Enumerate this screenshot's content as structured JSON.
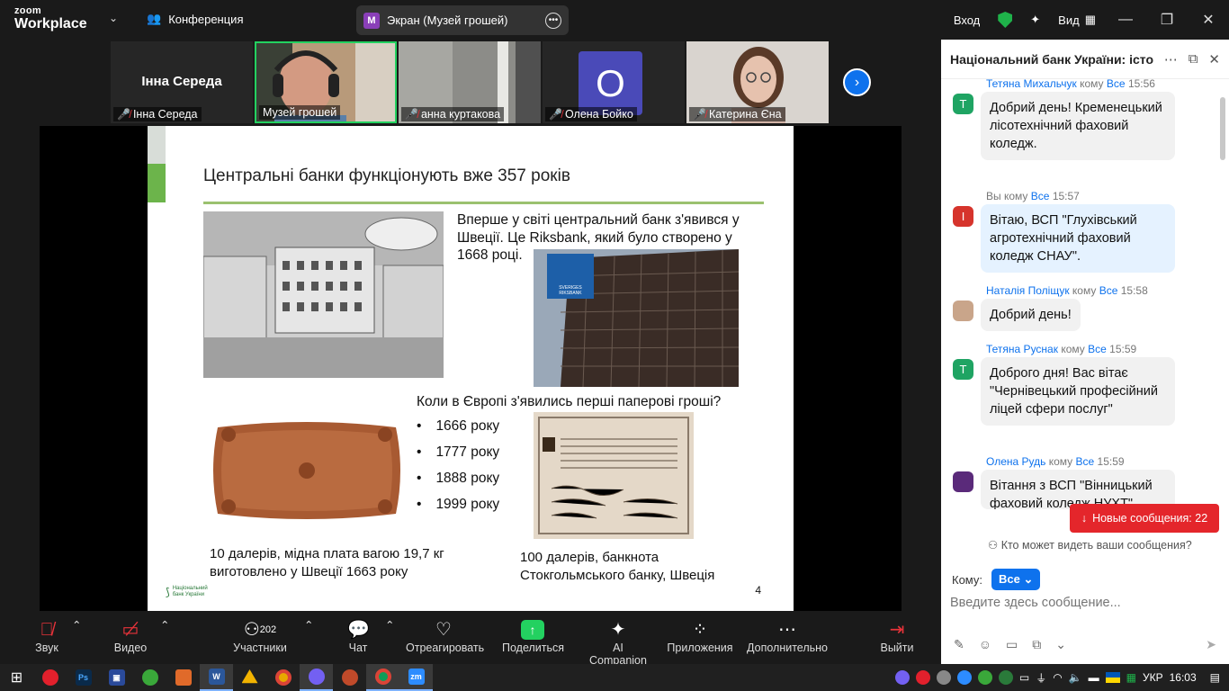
{
  "titlebar": {
    "logo_line1": "zoom",
    "logo_line2": "Workplace",
    "conference": "Конференция",
    "screen_label": "Экран (Музей грошей)",
    "screen_badge": "M",
    "signin": "Вход",
    "view": "Вид"
  },
  "gallery": {
    "tiles": [
      {
        "name": "Інна Середа",
        "big_name": "Інна Середа"
      },
      {
        "name": "Музей грошей"
      },
      {
        "name": "анна куртакова"
      },
      {
        "name": "Олена Бойко",
        "initial": "О"
      },
      {
        "name": "Катерина Єна"
      }
    ]
  },
  "slide": {
    "title": "Центральні банки функціонують вже 357 років",
    "intro": "Вперше у світі центральний банк з'явився у Швеції. Це Riksbank, який було створено у 1668 році.",
    "question": "Коли в Європі з'явились перші паперові гроші?",
    "options": [
      "1666 року",
      "1777 року",
      "1888 року",
      "1999 року"
    ],
    "caption_left": "10 далерів, мідна плата вагою 19,7 кг виготовлено у Швеції 1663 року",
    "caption_right": "100 далерів, банкнота Стокгольмського банку, Швеція",
    "page": "4",
    "footer_logo": "Національний банк України",
    "riksbank_label": "SVERIGES RIKSBANK"
  },
  "chat": {
    "title": "Національний банк України: істо...",
    "messages": [
      {
        "sender": "Тетяна Михальчук",
        "to_word": "кому",
        "to": "Все",
        "time": "15:56",
        "avatar": "T",
        "avatar_color": "#1fa463",
        "text": "Добрий день! Кременецький лісотехнічний фаховий коледж."
      },
      {
        "sender": "Вы",
        "to_word": "кому",
        "to": "Все",
        "time": "15:57",
        "avatar": "I",
        "avatar_color": "#d6342c",
        "text": "Вітаю, ВСП \"Глухівський агротехнічний фаховий коледж СНАУ\"."
      },
      {
        "sender": "Наталія Поліщук",
        "to_word": "кому",
        "to": "Все",
        "time": "15:58",
        "avatar": "",
        "avatar_color": "#c9a58a",
        "text": "Добрий день!"
      },
      {
        "sender": "Тетяна Руснак",
        "to_word": "кому",
        "to": "Все",
        "time": "15:59",
        "avatar": "T",
        "avatar_color": "#1fa463",
        "text": "Доброго дня! Вас вітає \"Чернівецький професійний ліцей сфери послуг\""
      },
      {
        "sender": "Олена Рудь",
        "to_word": "кому",
        "to": "Все",
        "time": "15:59",
        "avatar": "",
        "avatar_color": "#5a2a7a",
        "text": "Вітання з ВСП \"Вінницький фаховий коледж НУХТ\""
      }
    ],
    "new_messages": "Новые сообщения: 22",
    "who_sees": "Кто может видеть ваши сообщения?",
    "to_label": "Кому:",
    "to_value": "Все",
    "input_placeholder": "Введите здесь сообщение..."
  },
  "toolbar": {
    "audio": "Звук",
    "video": "Видео",
    "participants": "Участники",
    "participants_count": "202",
    "chat": "Чат",
    "react": "Отреагировать",
    "share": "Поделиться",
    "ai": "AI Companion",
    "apps": "Приложения",
    "more": "Дополнительно",
    "leave": "Выйти"
  },
  "taskbar": {
    "lang": "УКР",
    "time": "16:03"
  }
}
